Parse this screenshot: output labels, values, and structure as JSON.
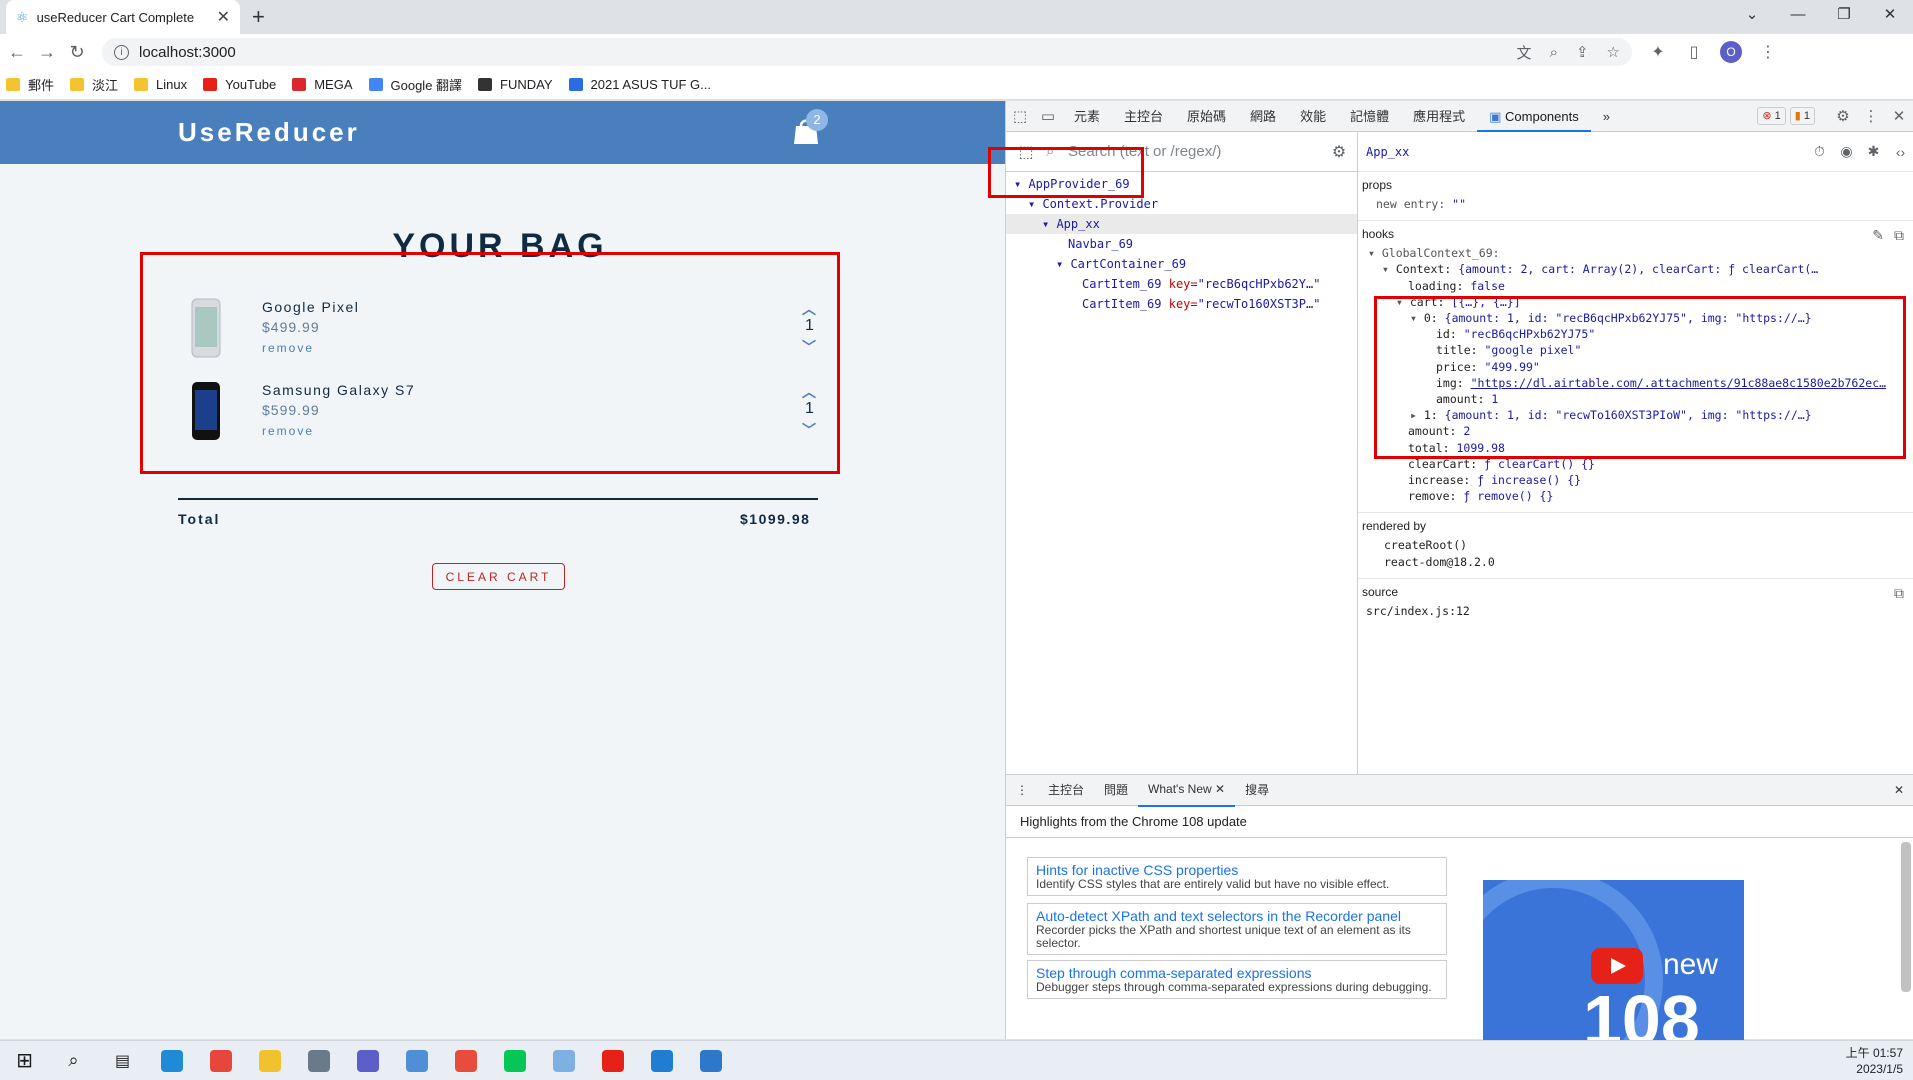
{
  "browser": {
    "tab_title": "useReducer Cart Complete",
    "url": "localhost:3000",
    "profile_initial": "O",
    "bookmarks": [
      {
        "label": "郵件",
        "color": "#f4c430"
      },
      {
        "label": "淡江",
        "color": "#f4c430"
      },
      {
        "label": "Linux",
        "color": "#f4c430"
      },
      {
        "label": "YouTube",
        "color": "#e62117"
      },
      {
        "label": "MEGA",
        "color": "#d9272e"
      },
      {
        "label": "Google 翻譯",
        "color": "#4285f4"
      },
      {
        "label": "FUNDAY",
        "color": "#333333"
      },
      {
        "label": "2021 ASUS TUF G...",
        "color": "#2a6de0"
      }
    ]
  },
  "app": {
    "brand": "UseReducer",
    "cart_count": "2",
    "bag_title": "YOUR BAG",
    "items": [
      {
        "name": "Google Pixel",
        "price": "$499.99",
        "remove": "remove",
        "amount": "1"
      },
      {
        "name": "Samsung Galaxy S7",
        "price": "$599.99",
        "remove": "remove",
        "amount": "1"
      }
    ],
    "total_label": "Total",
    "total_value": "$1099.98",
    "clear_label": "CLEAR CART"
  },
  "devtools": {
    "tabs": [
      "元素",
      "主控台",
      "原始碼",
      "網路",
      "效能",
      "記憶體",
      "應用程式",
      "Components"
    ],
    "more": "»",
    "error_count": "1",
    "warning_count": "1",
    "search_placeholder": "Search (text or /regex/)",
    "tree": [
      {
        "label": "AppProvider_69"
      },
      {
        "label": "Context.Provider"
      },
      {
        "label": "App_xx"
      },
      {
        "label": "Navbar_69"
      },
      {
        "label": "CartContainer_69"
      },
      {
        "label": "CartItem_69",
        "key": "key=",
        "keyval": "\"recB6qcHPxb62Y…\""
      },
      {
        "label": "CartItem_69",
        "key": "key=",
        "keyval": "\"recwTo160XST3P…\""
      }
    ],
    "selected_component": "App_xx",
    "props_header": "props",
    "props_line": {
      "k": "new entry",
      "v": "\"\""
    },
    "hooks_header": "hooks",
    "hooks": {
      "global": "GlobalContext_69:",
      "context_key": "Context",
      "context_val": "{amount: 2, cart: Array(2), clearCart: ƒ clearCart(…",
      "loading": "false",
      "cart_val": "[{…}, {…}]",
      "item0_val": "{amount: 1, id: \"recB6qcHPxb62YJ75\", img: \"https://…}",
      "id": "\"recB6qcHPxb62YJ75\"",
      "title": "\"google pixel\"",
      "price": "\"499.99\"",
      "img": "\"https://dl.airtable.com/.attachments/91c88ae8c1580e2b762ec…",
      "amount_inner": "1",
      "item1_val": "{amount: 1, id: \"recwTo160XST3PIoW\", img: \"https://…}",
      "amount": "2",
      "total": "1099.98",
      "clearCart": "ƒ clearCart() {}",
      "increase": "ƒ increase() {}",
      "remove": "ƒ remove() {}"
    },
    "rendered_by_header": "rendered by",
    "rendered_by": [
      "createRoot()",
      "react-dom@18.2.0"
    ],
    "source_header": "source",
    "source": "src/index.js:12",
    "drawer_tabs": [
      "主控台",
      "問題",
      "What's New",
      "搜尋"
    ],
    "highlights": "Highlights from the Chrome 108 update",
    "cards": [
      {
        "title": "Hints for inactive CSS properties",
        "desc": "Identify CSS styles that are entirely valid but have no visible effect."
      },
      {
        "title": "Auto-detect XPath and text selectors in the Recorder panel",
        "desc": "Recorder picks the XPath and shortest unique text of an element as its selector."
      },
      {
        "title": "Step through comma-separated expressions",
        "desc": "Debugger steps through comma-separated expressions during debugging."
      }
    ],
    "promo_new": "new",
    "promo_version": "108"
  },
  "taskbar": {
    "time": "上午 01:57",
    "date": "2023/1/5",
    "apps": [
      {
        "name": "edge-icon",
        "color": "#1d8bd6"
      },
      {
        "name": "chrome-icon",
        "color": "#e8453c"
      },
      {
        "name": "file-explorer-icon",
        "color": "#f2c12e"
      },
      {
        "name": "calculator-icon",
        "color": "#6b7a89"
      },
      {
        "name": "teams-icon",
        "color": "#5b5fc7"
      },
      {
        "name": "notepad-icon",
        "color": "#4f8fd6"
      },
      {
        "name": "paint-icon",
        "color": "#e84c3d"
      },
      {
        "name": "line-icon",
        "color": "#06c755"
      },
      {
        "name": "paint3d-icon",
        "color": "#7fb0e3"
      },
      {
        "name": "youtube-music-icon",
        "color": "#e62117"
      },
      {
        "name": "vscode-icon",
        "color": "#1f7ed1"
      },
      {
        "name": "photos-icon",
        "color": "#2e78c9"
      }
    ]
  }
}
